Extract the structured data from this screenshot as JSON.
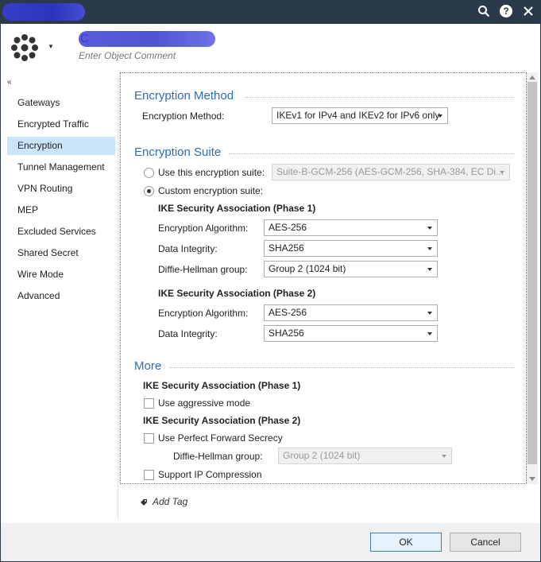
{
  "titlebar": {
    "icons": [
      "search-icon",
      "help-icon",
      "close-icon"
    ],
    "help_glyph": "?"
  },
  "header": {
    "object_name": "C",
    "object_comment_placeholder": "Enter Object Comment"
  },
  "sidebar": {
    "items": [
      {
        "label": "Gateways",
        "active": false
      },
      {
        "label": "Encrypted Traffic",
        "active": false
      },
      {
        "label": "Encryption",
        "active": true
      },
      {
        "label": "Tunnel Management",
        "active": false
      },
      {
        "label": "VPN Routing",
        "active": false
      },
      {
        "label": "MEP",
        "active": false
      },
      {
        "label": "Excluded Services",
        "active": false
      },
      {
        "label": "Shared Secret",
        "active": false
      },
      {
        "label": "Wire Mode",
        "active": false
      },
      {
        "label": "Advanced",
        "active": false
      }
    ]
  },
  "encryption_method": {
    "title": "Encryption Method",
    "label": "Encryption Method:",
    "value": "IKEv1 for IPv4 and IKEv2 for IPv6 only"
  },
  "encryption_suite": {
    "title": "Encryption Suite",
    "use_suite_label": "Use this encryption suite:",
    "use_suite_value": "Suite-B-GCM-256 (AES-GCM-256, SHA-384, EC Di...",
    "custom_suite_label": "Custom encryption suite:",
    "selected": "custom",
    "phase1": {
      "title": "IKE Security Association (Phase 1)",
      "enc_alg_label": "Encryption Algorithm:",
      "enc_alg_value": "AES-256",
      "integrity_label": "Data Integrity:",
      "integrity_value": "SHA256",
      "dh_label": "Diffie-Hellman group:",
      "dh_value": "Group 2 (1024 bit)"
    },
    "phase2": {
      "title": "IKE Security Association (Phase 2)",
      "enc_alg_label": "Encryption Algorithm:",
      "enc_alg_value": "AES-256",
      "integrity_label": "Data Integrity:",
      "integrity_value": "SHA256"
    }
  },
  "more": {
    "title": "More",
    "phase1_title": "IKE Security Association (Phase 1)",
    "aggressive_label": "Use aggressive mode",
    "aggressive_checked": false,
    "phase2_title": "IKE Security Association (Phase 2)",
    "pfs_label": "Use Perfect Forward Secrecy",
    "pfs_checked": false,
    "pfs_dh_label": "Diffie-Hellman group:",
    "pfs_dh_value": "Group 2 (1024 bit)",
    "compression_label": "Support IP Compression",
    "compression_checked": false
  },
  "tags": {
    "add_tag_label": "Add Tag"
  },
  "footer": {
    "ok_label": "OK",
    "cancel_label": "Cancel"
  }
}
